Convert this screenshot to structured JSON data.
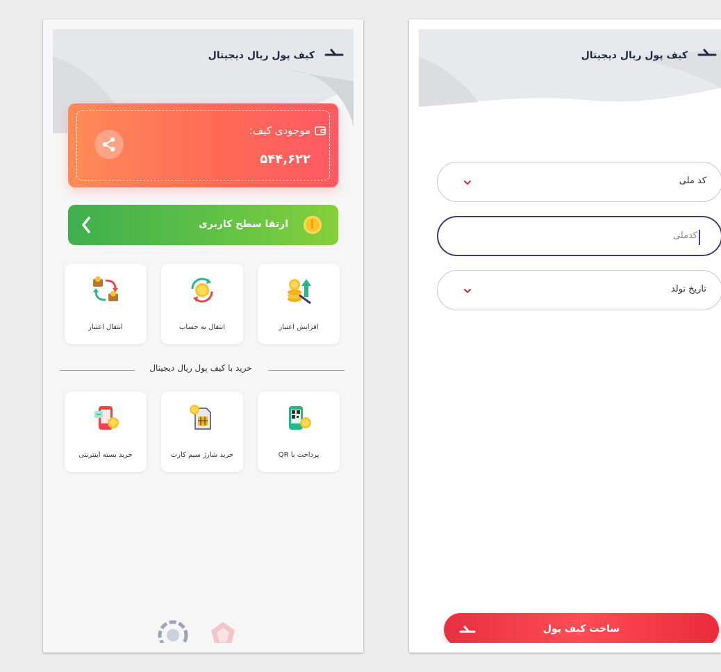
{
  "colors": {
    "title": "#1f2a44",
    "wallet_gradient_start": "#ff8b57",
    "wallet_gradient_end": "#ff5a63",
    "upgrade_gradient_start": "#3fae4e",
    "upgrade_gradient_end": "#86cf3c",
    "primary_button": "#e83040",
    "accent_red": "#d7263d"
  },
  "left_screen": {
    "header": {
      "title": "کیف پول ریال دیجیتال",
      "back_icon": "back-arrow-icon"
    },
    "wallet": {
      "label": "موجودی کیف:",
      "amount": "۵۴۴,۶۲۲",
      "wallet_icon": "wallet-icon",
      "share_icon": "share-icon"
    },
    "upgrade": {
      "label": "ارتقا سطح کاربری",
      "info_icon": "info-coin-icon",
      "chevron_icon": "chevron-left-icon"
    },
    "actions": [
      {
        "label": "افزایش اعتبار",
        "icon": "increase-credit-icon"
      },
      {
        "label": "انتقال به حساب",
        "icon": "transfer-to-account-icon"
      },
      {
        "label": "انتقال اعتبار",
        "icon": "transfer-credit-icon"
      }
    ],
    "section_title": "خرید با کیف پول ریال دیجیتال",
    "purchases": [
      {
        "label": "پرداخت با QR",
        "icon": "qr-payment-icon"
      },
      {
        "label": "خرید شارژ سیم کارت",
        "icon": "sim-charge-icon"
      },
      {
        "label": "خرید بسته اینترنتی",
        "icon": "internet-package-icon"
      }
    ],
    "footer_logos": [
      "bank-logo-icon",
      "partner-logo-icon"
    ]
  },
  "right_screen": {
    "header": {
      "title": "کیف پول ریال دیجیتال",
      "back_icon": "back-arrow-icon"
    },
    "fields": [
      {
        "label": "کد ملی",
        "type": "select"
      },
      {
        "placeholder": "کدملی",
        "type": "text"
      },
      {
        "label": "تاریخ تولد",
        "type": "select"
      }
    ],
    "submit": {
      "label": "ساخت کیف پول",
      "icon": "back-arrow-icon"
    }
  }
}
